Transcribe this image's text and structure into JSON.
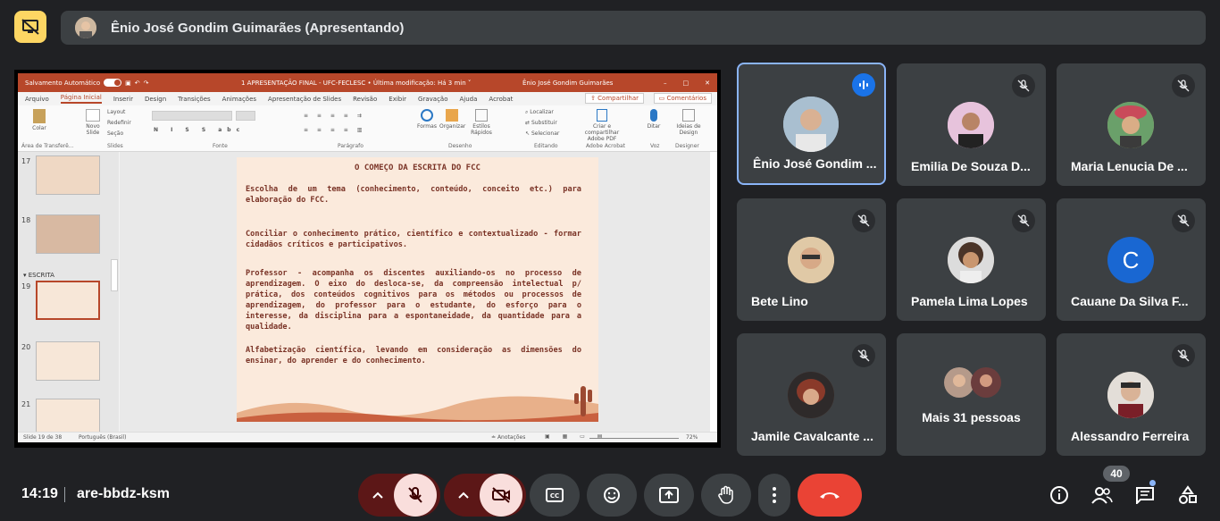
{
  "presenter_bar": {
    "title": "Ênio José Gondim Guimarães (Apresentando)"
  },
  "ppt": {
    "autosave": "Salvamento Automático",
    "doc_title": "1 APRESENTAÇÃO FINAL - UFC-FECLESC  •  Última modificação: Há 3 min  ˅",
    "user": "Ênio José Gondim Guimarães",
    "menu": [
      "Arquivo",
      "Página Inicial",
      "Inserir",
      "Design",
      "Transições",
      "Animações",
      "Apresentação de Slides",
      "Revisão",
      "Exibir",
      "Gravação",
      "Ajuda",
      "Acrobat"
    ],
    "share": "Compartilhar",
    "comments": "Comentários",
    "ribbon_groups": [
      "Área de Transferê...",
      "Slides",
      "Fonte",
      "Parágrafo",
      "Desenho",
      "Editando",
      "Adobe Acrobat",
      "Voz",
      "Designer"
    ],
    "ribbon_items": {
      "paste": "Colar",
      "new_slide": "Novo Slide",
      "layout": "Layout",
      "reset": "Redefinir",
      "section": "Seção",
      "shapes": "Formas",
      "arrange": "Organizar",
      "quick_styles": "Estilos Rápidos",
      "find": "Localizar",
      "replace": "Substituir",
      "select": "Selecionar",
      "create_pdf": "Criar e compartilhar Adobe PDF",
      "dictate": "Ditar",
      "design_ideas": "Ideias de Design"
    },
    "thumbs": [
      "17",
      "18",
      "19",
      "20",
      "21"
    ],
    "section_label": "ESCRITA",
    "status_left": "Slide 19 de 38",
    "status_lang": "Português (Brasil)",
    "status_notes": "Anotações",
    "status_zoom": "72%"
  },
  "slide": {
    "title": "O COMEÇO DA ESCRITA DO FCC",
    "p1": "Escolha de um tema (conhecimento, conteúdo, conceito etc.) para elaboração do FCC.",
    "p2": "Conciliar o conhecimento prático, científico e contextualizado - formar cidadãos críticos e participativos.",
    "p3": "Professor - acompanha os discentes auxiliando-os no processo de aprendizagem. O eixo do desloca-se, da compreensão intelectual p/ prática, dos conteúdos cognitivos para os métodos ou processos de aprendizagem, do professor para o estudante, do esforço para o interesse, da disciplina para a espontaneidade, da quantidade para a qualidade.",
    "p4": "Alfabetização científica, levando em consideração as dimensões do ensinar, do aprender e do conhecimento."
  },
  "participants": [
    {
      "name": "Ênio José Gondim ...",
      "speaking": true,
      "avatar_color": "#9fb4c7"
    },
    {
      "name": "Emilia De Souza D...",
      "speaking": false,
      "avatar_color": "#d9a5c8"
    },
    {
      "name": "Maria Lenucia De ...",
      "speaking": false,
      "avatar_color": "#c9a070"
    },
    {
      "name": "Bete Lino",
      "speaking": false,
      "avatar_color": "#d6b38a"
    },
    {
      "name": "Pamela Lima Lopes",
      "speaking": false,
      "avatar_color": "#b38f6d"
    },
    {
      "name": "Cauane Da Silva F...",
      "speaking": false,
      "avatar_letter": "C",
      "avatar_color": "#1967d2"
    },
    {
      "name": "Jamile Cavalcante ...",
      "speaking": false,
      "avatar_color": "#7a4a3a"
    },
    {
      "name": "Mais 31 pessoas",
      "speaking": false,
      "avatar_color": "#8a6a5a"
    },
    {
      "name": "Alessandro Ferreira",
      "speaking": false,
      "avatar_color": "#c8b09a"
    }
  ],
  "bottom": {
    "time": "14:19",
    "meeting_code": "are-bbdz-ksm",
    "people_count": "40"
  },
  "colors": {
    "background": "#202124",
    "tile": "#3c4043",
    "accent": "#8ab4f8",
    "hangup": "#ea4335",
    "muted_ctrl": "#f9dedc",
    "present_btn": "#fdd663"
  }
}
